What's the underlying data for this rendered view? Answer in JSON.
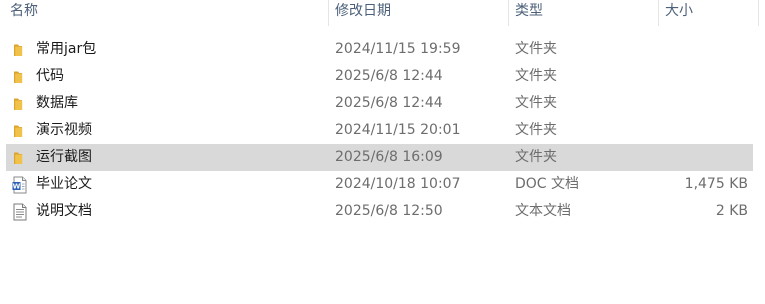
{
  "columns": {
    "name": "名称",
    "date": "修改日期",
    "type": "类型",
    "size": "大小"
  },
  "sort_caret": "^",
  "files": [
    {
      "name": "常用jar包",
      "date": "2024/11/15 19:59",
      "type": "文件夹",
      "size": "",
      "icon": "folder-icon",
      "selected": false
    },
    {
      "name": "代码",
      "date": "2025/6/8 12:44",
      "type": "文件夹",
      "size": "",
      "icon": "folder-icon",
      "selected": false
    },
    {
      "name": "数据库",
      "date": "2025/6/8 12:44",
      "type": "文件夹",
      "size": "",
      "icon": "folder-icon",
      "selected": false
    },
    {
      "name": "演示视频",
      "date": "2024/11/15 20:01",
      "type": "文件夹",
      "size": "",
      "icon": "folder-icon",
      "selected": false
    },
    {
      "name": "运行截图",
      "date": "2025/6/8 16:09",
      "type": "文件夹",
      "size": "",
      "icon": "folder-icon",
      "selected": true
    },
    {
      "name": "毕业论文",
      "date": "2024/10/18 10:07",
      "type": "DOC 文档",
      "size": "1,475 KB",
      "icon": "word-document-icon",
      "selected": false
    },
    {
      "name": "说明文档",
      "date": "2025/6/8 12:50",
      "type": "文本文档",
      "size": "2 KB",
      "icon": "text-document-icon",
      "selected": false
    }
  ],
  "colors": {
    "header_text": "#4c607a",
    "selected_row": "#d9d9d9",
    "folder": "#f0c24a"
  }
}
